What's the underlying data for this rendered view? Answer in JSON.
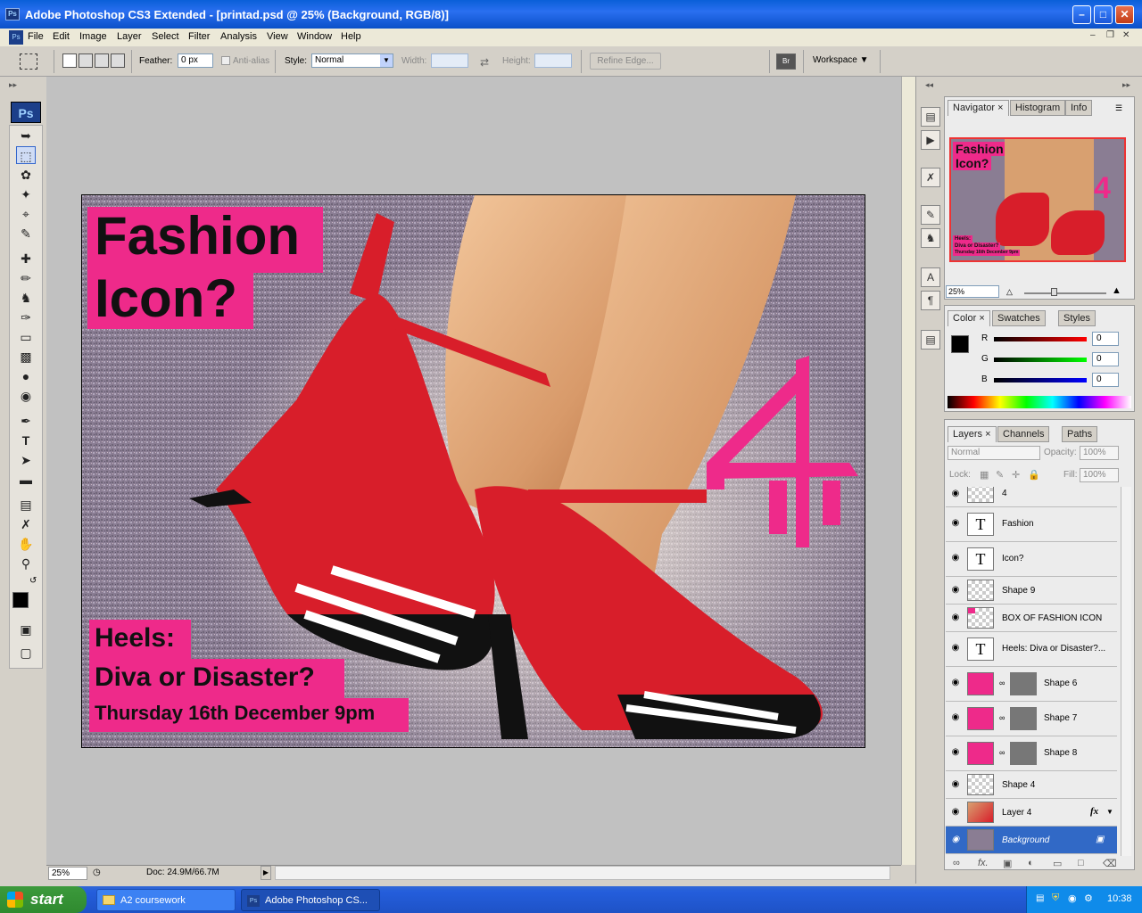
{
  "titlebar": {
    "app_abbr": "Ps",
    "title": "Adobe Photoshop CS3 Extended - [printad.psd @ 25% (Background, RGB/8)]"
  },
  "menubar": {
    "items": [
      "File",
      "Edit",
      "Image",
      "Layer",
      "Select",
      "Filter",
      "Analysis",
      "View",
      "Window",
      "Help"
    ]
  },
  "options": {
    "feather_label": "Feather:",
    "feather_value": "0 px",
    "antialias_label": "Anti-alias",
    "style_label": "Style:",
    "style_value": "Normal",
    "width_label": "Width:",
    "height_label": "Height:",
    "refine_label": "Refine Edge...",
    "workspace_label": "Workspace"
  },
  "toolbox": {
    "logo": "Ps"
  },
  "document": {
    "title_line1": "Fashion",
    "title_line2": "Icon?",
    "sub_line1": "Heels:",
    "sub_line2": "Diva or Disaster?",
    "sub_line3": "Thursday 16th December 9pm",
    "accent_color": "#ee2a8a"
  },
  "statusbar": {
    "zoom": "25%",
    "doc_info": "Doc: 24.9M/66.7M"
  },
  "navigator": {
    "tabs": [
      "Navigator",
      "Histogram",
      "Info"
    ],
    "zoom": "25%",
    "mini_title1": "Fashion",
    "mini_title2": "Icon?",
    "mini_sub1": "Heels:",
    "mini_sub2": "Diva or Disaster?",
    "mini_sub3": "Thursday 16th December 9pm"
  },
  "color_panel": {
    "tabs": [
      "Color",
      "Swatches",
      "Styles"
    ],
    "labels": [
      "R",
      "G",
      "B"
    ],
    "values": [
      "0",
      "0",
      "0"
    ]
  },
  "layers_panel": {
    "tabs": [
      "Layers",
      "Channels",
      "Paths"
    ],
    "blend_mode": "Normal",
    "opacity_label": "Opacity:",
    "opacity_value": "100%",
    "lock_label": "Lock:",
    "fill_label": "Fill:",
    "fill_value": "100%",
    "layers": [
      {
        "name": "4",
        "kind": "pixel"
      },
      {
        "name": "Fashion",
        "kind": "text"
      },
      {
        "name": "Icon?",
        "kind": "text"
      },
      {
        "name": "Shape 9",
        "kind": "pixel"
      },
      {
        "name": "BOX OF FASHION ICON",
        "kind": "pixel"
      },
      {
        "name": "Heels: Diva or Disaster?...",
        "kind": "text"
      },
      {
        "name": "Shape 6",
        "kind": "shape"
      },
      {
        "name": "Shape 7",
        "kind": "shape"
      },
      {
        "name": "Shape 8",
        "kind": "shape"
      },
      {
        "name": "Shape 4",
        "kind": "pixel"
      },
      {
        "name": "Layer 4",
        "kind": "photo"
      },
      {
        "name": "Background",
        "kind": "background"
      }
    ]
  },
  "taskbar": {
    "start_label": "start",
    "tasks": [
      "A2 coursework",
      "Adobe Photoshop CS..."
    ],
    "clock": "10:38"
  }
}
